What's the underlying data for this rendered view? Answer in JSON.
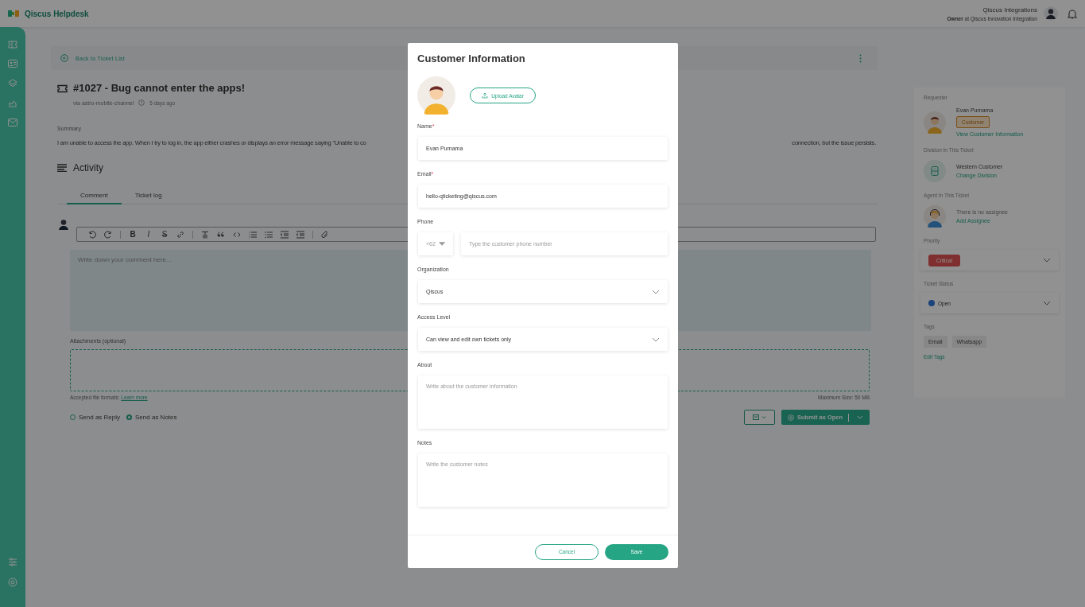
{
  "app": {
    "name": "Qiscus Helpdesk"
  },
  "user": {
    "name": "Qiscus Integrations",
    "role": "**Owner** at Qiscus Innovation Integration"
  },
  "ticket": {
    "back_link": "Back to Ticket List",
    "title": "#1027 - Bug cannot enter the apps!",
    "channel": "via astro-mobile-channel",
    "time": "5 days ago",
    "summary_label": "Summary",
    "summary_start": "I am unable to access the app. When I try to log in, the app either crashes or displays an error message saying \"Unable to co",
    "summary_end": "connection, but the issue persists."
  },
  "activity": {
    "title": "Activity",
    "tabs": [
      {
        "label": "Comment",
        "selected": true
      },
      {
        "label": "Ticket log",
        "selected": false
      }
    ],
    "format_glyphs": [
      "B",
      "I",
      "S"
    ],
    "editor_placeholder": "Write down your comment here...",
    "attachments_label": "Attachments (optional)",
    "formats_note": "Accepted file formats:",
    "learn_more": "Learn more",
    "max_size": "Maximum Size: 50 MB",
    "send_options": [
      {
        "label": "Send as Reply",
        "selected": false
      },
      {
        "label": "Send as Notes",
        "selected": true
      }
    ],
    "submit": "Submit as Open"
  },
  "details": {
    "requester_label": "Requester",
    "requester_name": "Evan Purnama",
    "requester_badge": "Customer",
    "view_link": "View Customer Information",
    "division_label": "Division In This Ticket",
    "division": "Western Customer",
    "change_division": "Change Division",
    "agent_label": "Agent In This Ticket",
    "no_assignee": "There is no assignee",
    "add_assignee": "Add Assignee",
    "priority_label": "Priority",
    "priority": "Critical",
    "status_label": "Ticket Status",
    "status": "Open",
    "tags_label": "Tags",
    "tags": [
      "Email",
      "Whatsapp"
    ],
    "edit_tags": "Edit Tags"
  },
  "modal": {
    "title": "Customer Information",
    "upload": "Upload Avatar",
    "fields": [
      {
        "kind": "text",
        "label": "Name",
        "required_mark": "*",
        "value": "Evan Purnama"
      },
      {
        "kind": "text",
        "label": "Email",
        "required_mark": "*",
        "value": "hello-qticketing@qiscus.com"
      },
      {
        "kind": "phone",
        "label": "Phone",
        "code": "+62",
        "placeholder": "Type the customer phone number"
      },
      {
        "kind": "select",
        "label": "Organization",
        "value": "Qiscus"
      },
      {
        "kind": "select",
        "label": "Access Level",
        "value": "Can view and edit own tickets only"
      },
      {
        "kind": "textarea",
        "label": "About",
        "placeholder": "Write about the customer information"
      },
      {
        "kind": "textarea",
        "label": "Notes",
        "placeholder": "Write the customer notes"
      }
    ],
    "cancel": "Cancel",
    "save": "Save"
  }
}
